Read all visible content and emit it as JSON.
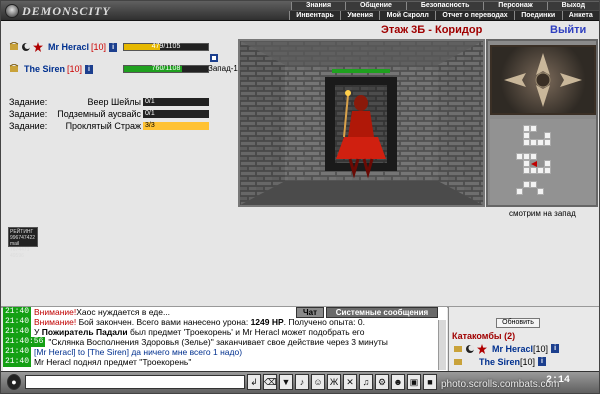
{
  "app": {
    "logo": "DEMONSCITY"
  },
  "menu": {
    "row1": [
      "Знания",
      "Общение",
      "Безопасность",
      "Персонаж",
      "Выход"
    ],
    "row2": [
      "Инвентарь",
      "Умения",
      "Мой Скролл",
      "Отчет о переводах",
      "Поединки",
      "Анкета"
    ]
  },
  "players": [
    {
      "name": "Mr Heracl",
      "level": "[10]",
      "hp_text": "479/1105",
      "hp_fraction": 0.43,
      "hp_color": "#e6b800"
    },
    {
      "name": "The Siren",
      "level": "[10]",
      "hp_text": "760/1108",
      "hp_fraction": 0.69,
      "hp_color": "#1fa01f"
    }
  ],
  "direction": "Запад-1",
  "quests": [
    {
      "label": "Задание:",
      "name": "Веер Шейлы",
      "progress": "0/1",
      "fraction": 0
    },
    {
      "label": "Задание:",
      "name": "Подземный аусвайс",
      "progress": "0/1",
      "fraction": 0
    },
    {
      "label": "Задание:",
      "name": "Проклятый Страж",
      "progress": "3/3",
      "fraction": 1
    }
  ],
  "room": {
    "title": "Этаж 3Б - Коридор",
    "exit": "Выйти",
    "facing": "смотрим на запад"
  },
  "stats_box": {
    "line1": "РЕЙТИНГ 996747422",
    "line2": "mail 7674471",
    "line3": "49596"
  },
  "chat": {
    "tab_chat": "Чат",
    "tab_system": "Системные сообщения",
    "messages": [
      {
        "time": "21:40",
        "prefix": "Внимание!",
        "text": " Хаос нуждается в еде..."
      },
      {
        "time": "21:40",
        "prefix": "Внимание!",
        "text": " Бой закончен. Всего вами нанесено урона: ",
        "bold": "1249 HP",
        "tail": ". Получено опыта: 0."
      },
      {
        "time": "21:40",
        "prefix": "",
        "text": "У ",
        "bold": "Пожиратель Падали",
        "tail": " был предмет 'Трoекорень' и Mr Heracl может подобрать его"
      },
      {
        "time": "21:40:56",
        "prefix": "",
        "text": "\"Склянка Восполнения Здоровья (Зелье)\" заканчивает свое действие через 3 минуты"
      },
      {
        "time": "21:40",
        "prefix": "",
        "text": "[Mr Heracl] to [The Siren] да ничего мне всего 1 надо)"
      },
      {
        "time": "21:40",
        "prefix": "",
        "text": "Mr Heracl поднял предмет \"Трoекорень\""
      }
    ]
  },
  "right_panel": {
    "refresh": "Обновить",
    "location": "Катакомбы (2)",
    "members": [
      {
        "name": "Mr Heracl",
        "level": "[10]"
      },
      {
        "name": "The Siren",
        "level": "[10]"
      }
    ]
  },
  "toolbar": {
    "clock": "2:14"
  },
  "watermark": "photo.scrolls.combats.com"
}
